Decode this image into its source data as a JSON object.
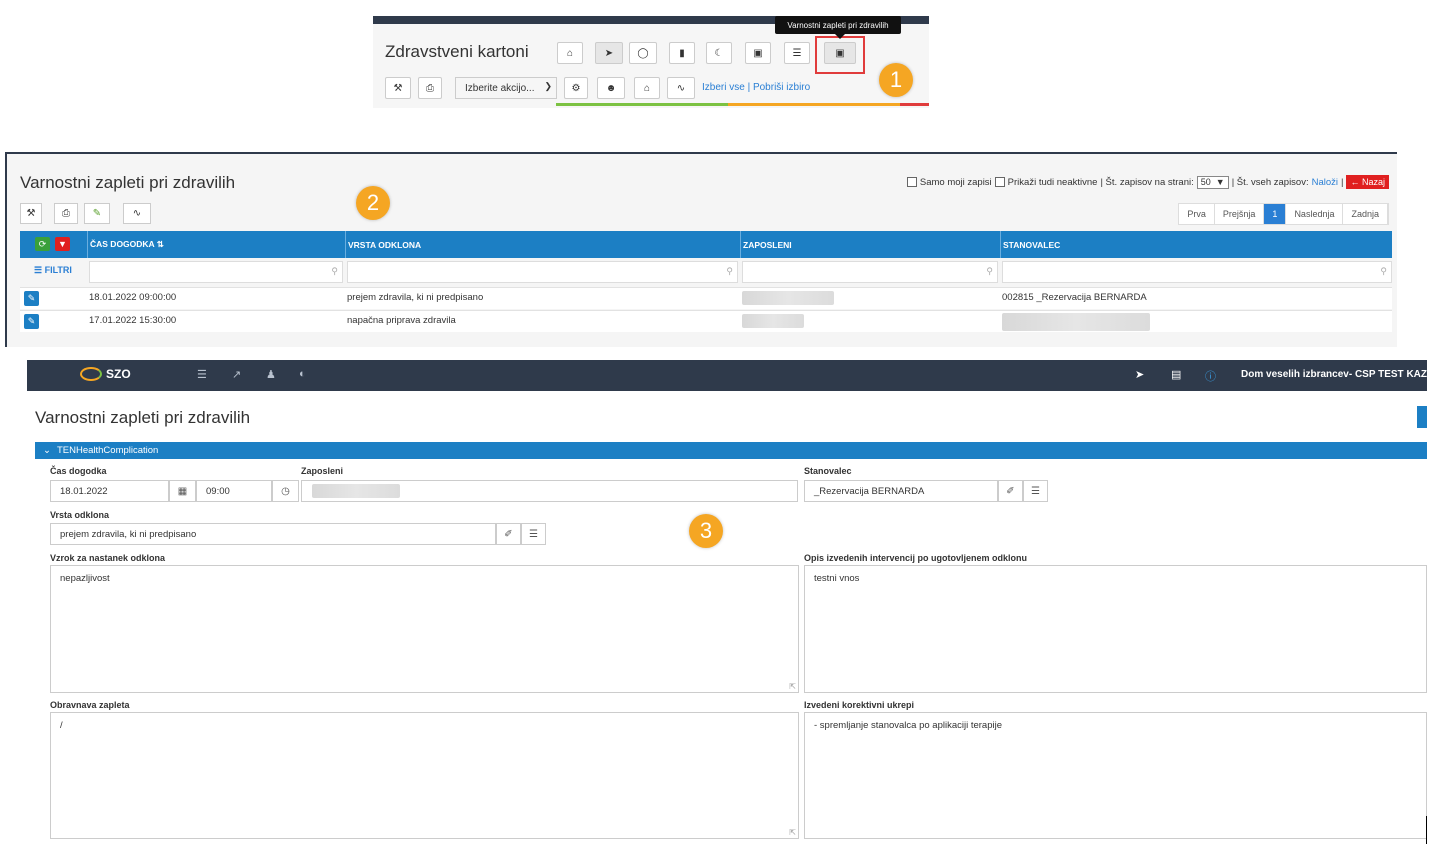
{
  "panel1": {
    "title": "Zdravstveni kartoni",
    "tooltip": "Varnostni zapleti pri zdravilih",
    "select_value": "Izberite akcijo...",
    "link_select_all": "Izberi vse",
    "link_separator": " | ",
    "link_clear": "Pobriši izbiro",
    "badge": "1",
    "toolbar_icons": [
      "home-icon",
      "plane-icon",
      "comment-icon",
      "book-icon",
      "moon-icon",
      "camera-icon",
      "list-icon",
      "briefcase-medical-icon"
    ],
    "toolbar2_icons": [
      "wrench-icon",
      "print-icon",
      "gear-icon",
      "users-icon",
      "home-icon",
      "chart-icon"
    ]
  },
  "panel2": {
    "title": "Varnostni zapleti pri zdravilih",
    "opt_only_mine": "Samo moji zapisi",
    "opt_show_inactive": "Prikaži tudi neaktivne",
    "per_page_label": "| Št. zapisov na strani:",
    "per_page_value": "50",
    "total_label": "| Št. vseh zapisov:",
    "load_link": "Naloži",
    "back_button": "← Nazaj",
    "badge": "2",
    "pager": {
      "first": "Prva",
      "prev": "Prejšnja",
      "current": "1",
      "next": "Naslednja",
      "last": "Zadnja"
    },
    "columns": [
      "ČAS DOGODKA ⇅",
      "VRSTA ODKLONA",
      "ZAPOSLENI",
      "STANOVALEC"
    ],
    "filter_label": "☰ FILTRI",
    "rows": [
      {
        "time": "18.01.2022 09:00:00",
        "type": "prejem zdravila, ki ni predpisano",
        "resident": "002815 _Rezervacija BERNARDA"
      },
      {
        "time": "17.01.2022 15:30:00",
        "type": "napačna priprava zdravila",
        "resident": ""
      }
    ]
  },
  "panel3": {
    "logo": "SZO",
    "org": "Dom veselih izbrancev- CSP TEST KAZ",
    "title": "Varnostni zapleti pri zdravilih",
    "section": "TENHealthComplication",
    "badge": "3",
    "labels": {
      "time": "Čas dogodka",
      "employee": "Zaposleni",
      "resident": "Stanovalec",
      "type": "Vrsta odklona",
      "cause": "Vzrok za nastanek odklona",
      "interventions": "Opis izvedenih intervencij po ugotovljenem odklonu",
      "handling": "Obravnava zapleta",
      "corrective": "Izvedeni korektivni ukrepi"
    },
    "values": {
      "date": "18.01.2022",
      "time": "09:00",
      "resident": "_Rezervacija BERNARDA",
      "type": "prejem zdravila, ki ni predpisano",
      "cause": "nepazljivost",
      "interventions": "testni vnos",
      "handling": "/",
      "corrective": "- spremljanje stanovalca po aplikaciji terapije"
    }
  }
}
